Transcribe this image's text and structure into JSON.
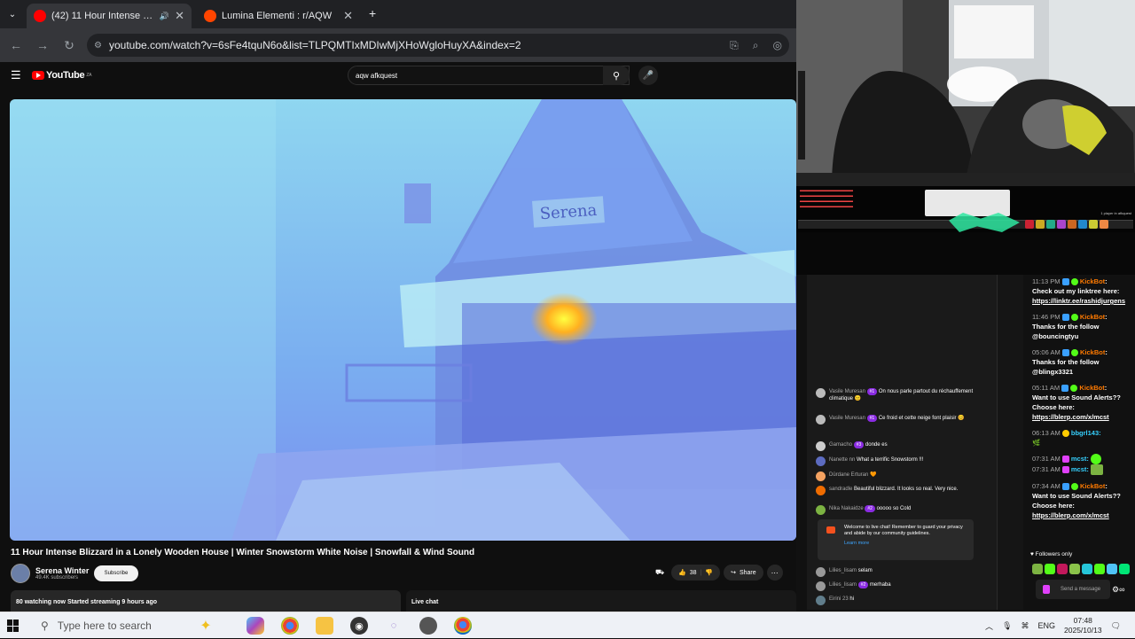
{
  "browser": {
    "tabs": [
      {
        "title": "(42) 11 Hour Intense Blizzard",
        "active": true,
        "favicon_color": "#ff0000",
        "audio": true
      },
      {
        "title": "Lumina Elementi : r/AQW",
        "active": false,
        "favicon_color": "#ff4500"
      }
    ],
    "url": "youtube.com/watch?v=6sFe4tquN6o&list=TLPQMTIxMDIwMjXHoWgloHuyXA&index=2"
  },
  "youtube": {
    "logo_text": "YouTube",
    "logo_sup": "ZA",
    "search_value": "aqw afkquest",
    "video_title": "11 Hour Intense Blizzard in a Lonely Wooden House | Winter Snowstorm White Noise | Snowfall & Wind Sound",
    "house_sign": "Serena",
    "channel_name": "Serena Winter",
    "subscribers": "49.4K subscribers",
    "subscribe_label": "Subscribe",
    "likes": "38",
    "share_label": "Share",
    "watching_text": "80 watching now  Started streaming 9 hours ago",
    "livechat_label": "Live chat"
  },
  "overlay": {
    "game_label": "1 player in afkquest",
    "youtube_chat": [
      {
        "author": "Vasile Muresan",
        "badge": "#1",
        "text": "On nous parle partout du réchauffement climatique",
        "color": "#bbbbbb"
      },
      {
        "author": "Vasile Muresan",
        "badge": "#1",
        "text": "Ce froid et cette neige font plaisir",
        "color": "#bbbbbb"
      },
      {
        "author": "Gamacho",
        "badge": "#3",
        "text": "donde es",
        "color": "#cccccc"
      },
      {
        "author": "Nanette nn",
        "badge": "",
        "text": "What a terrific Snowstorm !!!",
        "color": "#5c6bc0"
      },
      {
        "author": "Dürdane Erturan",
        "badge": "",
        "text": "🧡",
        "color": "#f4a261"
      },
      {
        "author": "sandradle",
        "badge": "",
        "text": "Beautiful blizzard. It looks so real. Very nice.",
        "color": "#ef6c00"
      },
      {
        "author": "Nika Nakaidze",
        "badge": "#2",
        "text": "ooooo so Cold",
        "color": "#7cb342"
      }
    ],
    "welcome_text": "Welcome to live chat! Remember to guard your privacy and abide by our community guidelines.",
    "learn_more": "Learn more",
    "youtube_chat_after": [
      {
        "author": "Lilies_lisam",
        "badge": "",
        "text": "selam",
        "color": "#999999"
      },
      {
        "author": "Lilies_lisam",
        "badge": "#2",
        "text": "merhaba",
        "color": "#999999"
      },
      {
        "author": "Eirini 23",
        "badge": "",
        "text": "hi",
        "color": "#607d8b"
      }
    ],
    "kick_chat": [
      {
        "time": "11:13 PM",
        "user": "KickBot",
        "text": "Check out my linktree here:",
        "link": "https://linktr.ee/rashidjurgens"
      },
      {
        "time": "11:46 PM",
        "user": "KickBot",
        "text": "Thanks for the follow @bouncingtyu",
        "link": ""
      },
      {
        "time": "05:06 AM",
        "user": "KickBot",
        "text": "Thanks for the follow @blingx3321",
        "link": ""
      },
      {
        "time": "05:11 AM",
        "user": "KickBot",
        "text": "Want to use Sound Alerts?? Choose here:",
        "link": "https://blerp.com/x/mcst"
      },
      {
        "time": "06:13 AM",
        "user": "bbgrl143:",
        "text": "🌿",
        "link": ""
      },
      {
        "time": "07:31 AM",
        "user": "mcst:",
        "text": "",
        "link": ""
      },
      {
        "time": "07:31 AM",
        "user": "mcst:",
        "text": "",
        "link": ""
      },
      {
        "time": "07:34 AM",
        "user": "KickBot",
        "text": "Want to use Sound Alerts?? Choose here:",
        "link": "https://blerp.com/x/mcst"
      }
    ],
    "followers_only": "Followers only",
    "send_placeholder": "Send a message"
  },
  "taskbar": {
    "search_placeholder": "Type here to search",
    "language": "ENG",
    "time": "07:48",
    "date": "2025/10/13"
  }
}
